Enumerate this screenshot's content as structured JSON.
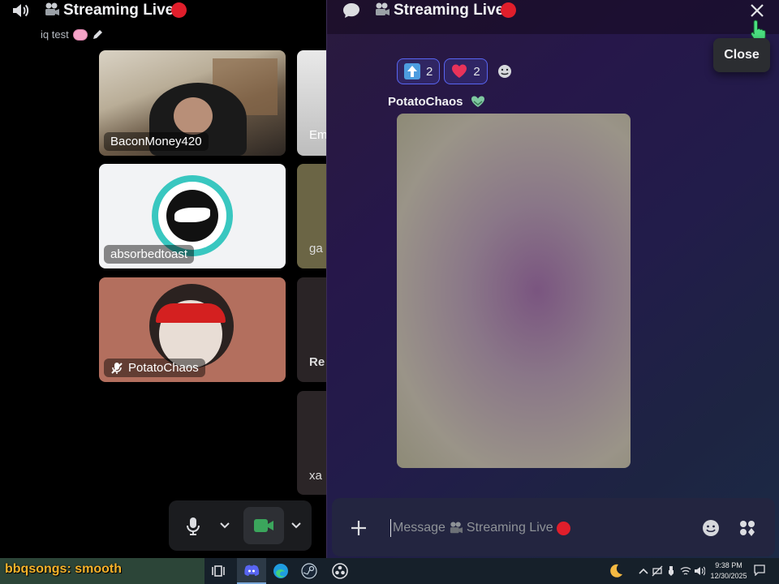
{
  "voice": {
    "channel_name": "Streaming Live",
    "status_text": "iq test",
    "tiles": [
      {
        "name": "BaconMoney420"
      },
      {
        "name": "absorbedtoast"
      },
      {
        "name": "PotatoChaos"
      }
    ],
    "side_tiles": [
      {
        "name": "Em"
      },
      {
        "name": "ga"
      },
      {
        "name": "Re"
      },
      {
        "name": "xa"
      }
    ]
  },
  "chat": {
    "title": "Streaming Live",
    "close_tooltip": "Close",
    "reactions": [
      {
        "icon": "up-arrow-icon",
        "count": "2"
      },
      {
        "icon": "heart-icon",
        "count": "2"
      }
    ],
    "author": "PotatoChaos",
    "input_placeholder": "Message",
    "input_channel": "Streaming Live"
  },
  "taskbar": {
    "now_playing": "bbqsongs: smooth",
    "time": "9:38 PM",
    "date": "12/30/2025"
  },
  "colors": {
    "live": "#e01e2b",
    "accent": "#5865f2",
    "heart": "#e8335a",
    "camera_on": "#3ba55c"
  }
}
